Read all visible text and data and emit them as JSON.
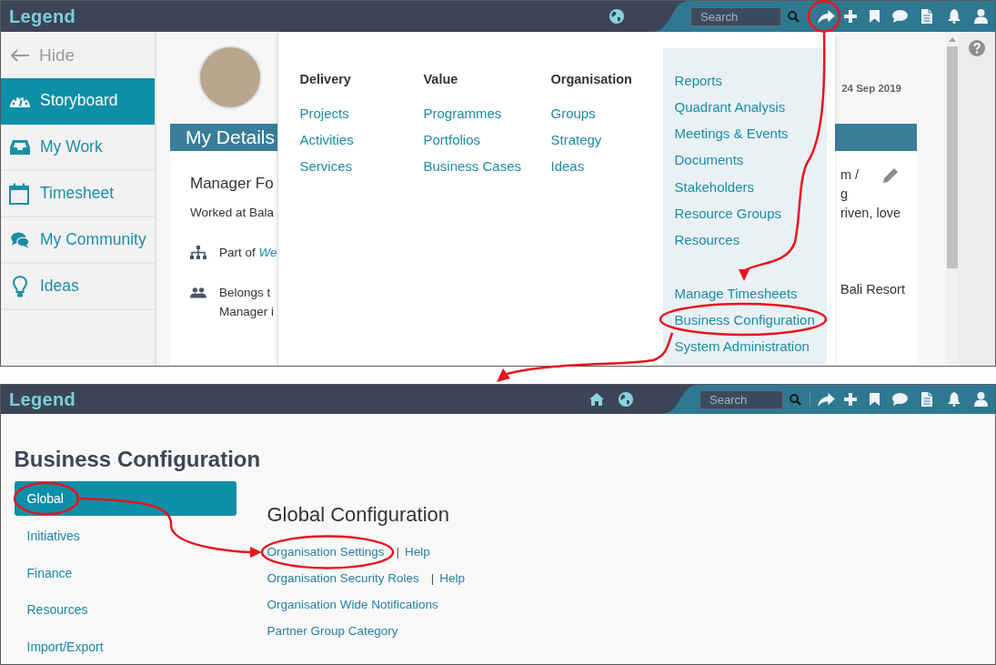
{
  "top_screen": {
    "header": {
      "logo": "Legend",
      "search": {
        "placeholder": "Search"
      }
    },
    "sidebar": {
      "hide_label": "Hide",
      "items": [
        {
          "label": "Storyboard",
          "selected": true
        },
        {
          "label": "My Work",
          "selected": false
        },
        {
          "label": "Timesheet",
          "selected": false
        },
        {
          "label": "My Community",
          "selected": false
        },
        {
          "label": "Ideas",
          "selected": false
        }
      ]
    },
    "profile": {
      "date": "24 Sep 2019",
      "section_title": "My Details",
      "title": "Manager Fo",
      "summary": "Worked at Bala",
      "part_of": "Part of *We*",
      "belongs_to": [
        "Belongs t",
        "Manager i"
      ],
      "right_fragments": [
        "m /",
        "g",
        "riven, love",
        "Bali Resort"
      ]
    },
    "menu": {
      "columns": [
        {
          "heading": "Delivery",
          "links": [
            "Projects",
            "Activities",
            "Services"
          ]
        },
        {
          "heading": "Value",
          "links": [
            "Programmes",
            "Portfolios",
            "Business Cases"
          ]
        },
        {
          "heading": "Organisation",
          "links": [
            "Groups",
            "Strategy",
            "Ideas"
          ]
        }
      ],
      "side_groups": [
        [
          "Reports",
          "Quadrant Analysis",
          "Meetings & Events",
          "Documents",
          "Stakeholders",
          "Resource Groups",
          "Resources"
        ],
        [
          "Manage Timesheets",
          "Business Configuration",
          "System Administration"
        ]
      ]
    }
  },
  "bottom_screen": {
    "header": {
      "logo": "Legend",
      "search": {
        "placeholder": "Search"
      }
    },
    "page_title": "Business Configuration",
    "nav": [
      {
        "label": "Global",
        "selected": true
      },
      {
        "label": "Initiatives",
        "selected": false
      },
      {
        "label": "Finance",
        "selected": false
      },
      {
        "label": "Resources",
        "selected": false
      },
      {
        "label": "Import/Export",
        "selected": false
      }
    ],
    "section_title": "Global Configuration",
    "settings": [
      {
        "label": "Organisation Settings",
        "separator": "|",
        "help": "Help"
      },
      {
        "label": "Organisation Security Roles",
        "separator": "|",
        "help": "Help"
      },
      {
        "label": "Organisation Wide Notifications"
      },
      {
        "label": "Partner Group Category"
      }
    ]
  }
}
